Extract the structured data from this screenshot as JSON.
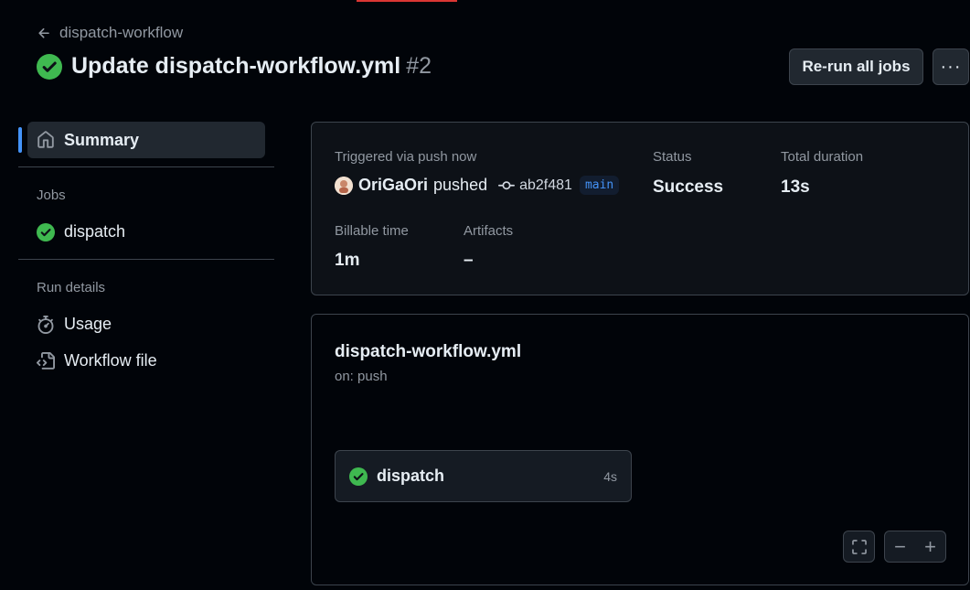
{
  "header": {
    "back_label": "dispatch-workflow",
    "title": "Update dispatch-workflow.yml",
    "run_number": "#2",
    "rerun_label": "Re-run all jobs",
    "more_label": "···"
  },
  "sidebar": {
    "summary_label": "Summary",
    "jobs_heading": "Jobs",
    "jobs": [
      {
        "label": "dispatch",
        "status": "success"
      }
    ],
    "run_details_heading": "Run details",
    "usage_label": "Usage",
    "workflow_file_label": "Workflow file"
  },
  "summary": {
    "trigger_label": "Triggered via push now",
    "user": "OriGaOri",
    "action": "pushed",
    "commit": "ab2f481",
    "branch": "main",
    "status_label": "Status",
    "status_value": "Success",
    "duration_label": "Total duration",
    "duration_value": "13s",
    "billable_label": "Billable time",
    "billable_value": "1m",
    "artifacts_label": "Artifacts",
    "artifacts_value": "–"
  },
  "graph": {
    "workflow_name": "dispatch-workflow.yml",
    "trigger": "on: push",
    "job_name": "dispatch",
    "job_duration": "4s",
    "zoom_out_label": "−",
    "zoom_in_label": "+"
  },
  "colors": {
    "success": "#3fb950",
    "accent": "#4493f8",
    "background": "#010409"
  }
}
